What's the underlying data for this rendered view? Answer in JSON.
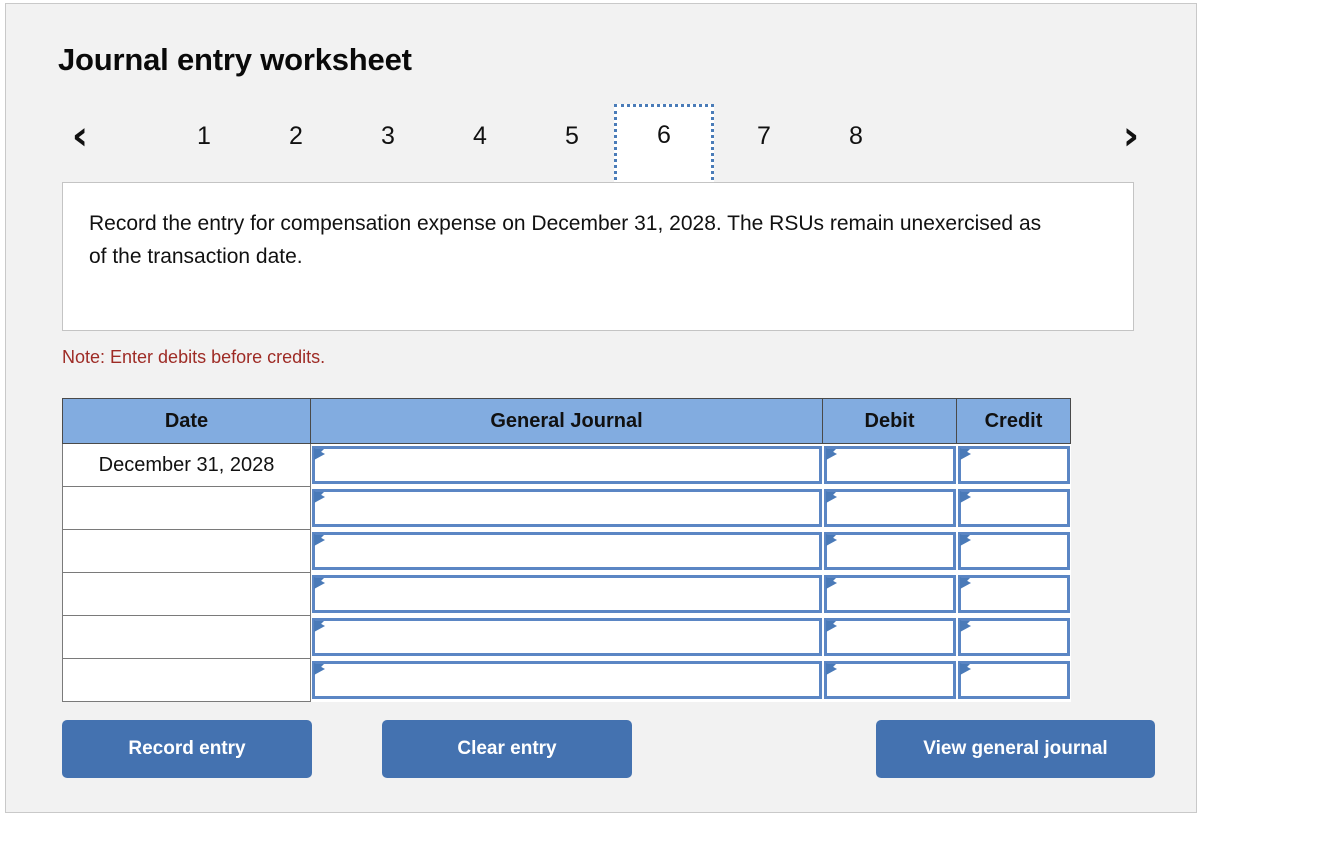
{
  "page": {
    "title": "Journal entry worksheet"
  },
  "pager": {
    "prev_icon": "chevron-left-icon",
    "next_icon": "chevron-right-icon",
    "prev_glyph": "‹",
    "next_glyph": "›",
    "tabs": [
      "1",
      "2",
      "3",
      "4",
      "5",
      "6",
      "7",
      "8"
    ],
    "active_tab": "6"
  },
  "instruction": {
    "text": "Record the entry for compensation expense on December 31, 2028. The RSUs remain unexercised as of the transaction date."
  },
  "note": {
    "text": "Note: Enter debits before credits."
  },
  "table": {
    "headers": [
      "Date",
      "General Journal",
      "Debit",
      "Credit"
    ],
    "rows": [
      {
        "date": "December 31, 2028",
        "general_journal": "",
        "debit": "",
        "credit": ""
      },
      {
        "date": "",
        "general_journal": "",
        "debit": "",
        "credit": ""
      },
      {
        "date": "",
        "general_journal": "",
        "debit": "",
        "credit": ""
      },
      {
        "date": "",
        "general_journal": "",
        "debit": "",
        "credit": ""
      },
      {
        "date": "",
        "general_journal": "",
        "debit": "",
        "credit": ""
      },
      {
        "date": "",
        "general_journal": "",
        "debit": "",
        "credit": ""
      }
    ]
  },
  "buttons": {
    "record": "Record entry",
    "clear": "Clear entry",
    "view": "View general journal"
  },
  "colors": {
    "panel_bg": "#f2f2f2",
    "header_blue": "#82ACE0",
    "button_blue": "#4472B0",
    "note_red": "#9e2b25",
    "cell_border_blue": "#5b86c4",
    "active_tab_border": "#4a7cb8"
  }
}
